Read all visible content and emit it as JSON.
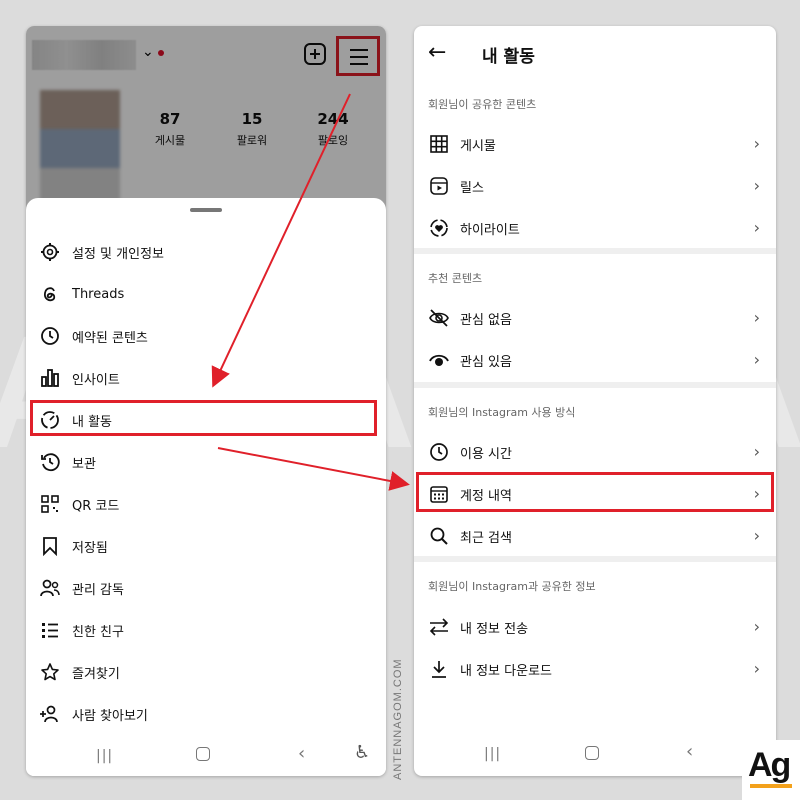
{
  "left_screen": {
    "profile": {
      "stats": [
        {
          "value": "87",
          "label": "게시물"
        },
        {
          "value": "15",
          "label": "팔로워"
        },
        {
          "value": "244",
          "label": "팔로잉"
        }
      ]
    },
    "menu": [
      {
        "label": "설정 및 개인정보",
        "icon": "settings-icon"
      },
      {
        "label": "Threads",
        "icon": "threads-icon"
      },
      {
        "label": "예약된 콘텐츠",
        "icon": "clock-icon"
      },
      {
        "label": "인사이트",
        "icon": "bar-chart-icon"
      },
      {
        "label": "내 활동",
        "icon": "activity-icon"
      },
      {
        "label": "보관",
        "icon": "archive-icon"
      },
      {
        "label": "QR 코드",
        "icon": "qr-code-icon"
      },
      {
        "label": "저장됨",
        "icon": "bookmark-icon"
      },
      {
        "label": "관리 감독",
        "icon": "supervision-icon"
      },
      {
        "label": "친한 친구",
        "icon": "close-friends-icon"
      },
      {
        "label": "즐겨찾기",
        "icon": "star-icon"
      },
      {
        "label": "사람 찾아보기",
        "icon": "add-person-icon"
      }
    ]
  },
  "right_screen": {
    "title": "내 활동",
    "sections": [
      {
        "title": "회원님이 공유한 콘텐츠",
        "items": [
          {
            "label": "게시물",
            "icon": "grid-icon"
          },
          {
            "label": "릴스",
            "icon": "reels-icon"
          },
          {
            "label": "하이라이트",
            "icon": "highlight-icon"
          }
        ]
      },
      {
        "title": "추천 콘텐츠",
        "items": [
          {
            "label": "관심 없음",
            "icon": "eye-off-icon"
          },
          {
            "label": "관심 있음",
            "icon": "eye-icon"
          }
        ]
      },
      {
        "title": "회원님의 Instagram 사용 방식",
        "items": [
          {
            "label": "이용 시간",
            "icon": "clock-icon"
          },
          {
            "label": "계정 내역",
            "icon": "calendar-icon"
          },
          {
            "label": "최근 검색",
            "icon": "search-icon"
          }
        ]
      },
      {
        "title": "회원님이 Instagram과 공유한 정보",
        "items": [
          {
            "label": "내 정보 전송",
            "icon": "transfer-icon"
          },
          {
            "label": "내 정보 다운로드",
            "icon": "download-icon"
          }
        ]
      }
    ]
  },
  "watermark": {
    "site": "ANTENNAGOM.COM",
    "logo": "Ag"
  },
  "colors": {
    "highlight": "#e0202a",
    "logo_accent": "#f3a11b"
  }
}
